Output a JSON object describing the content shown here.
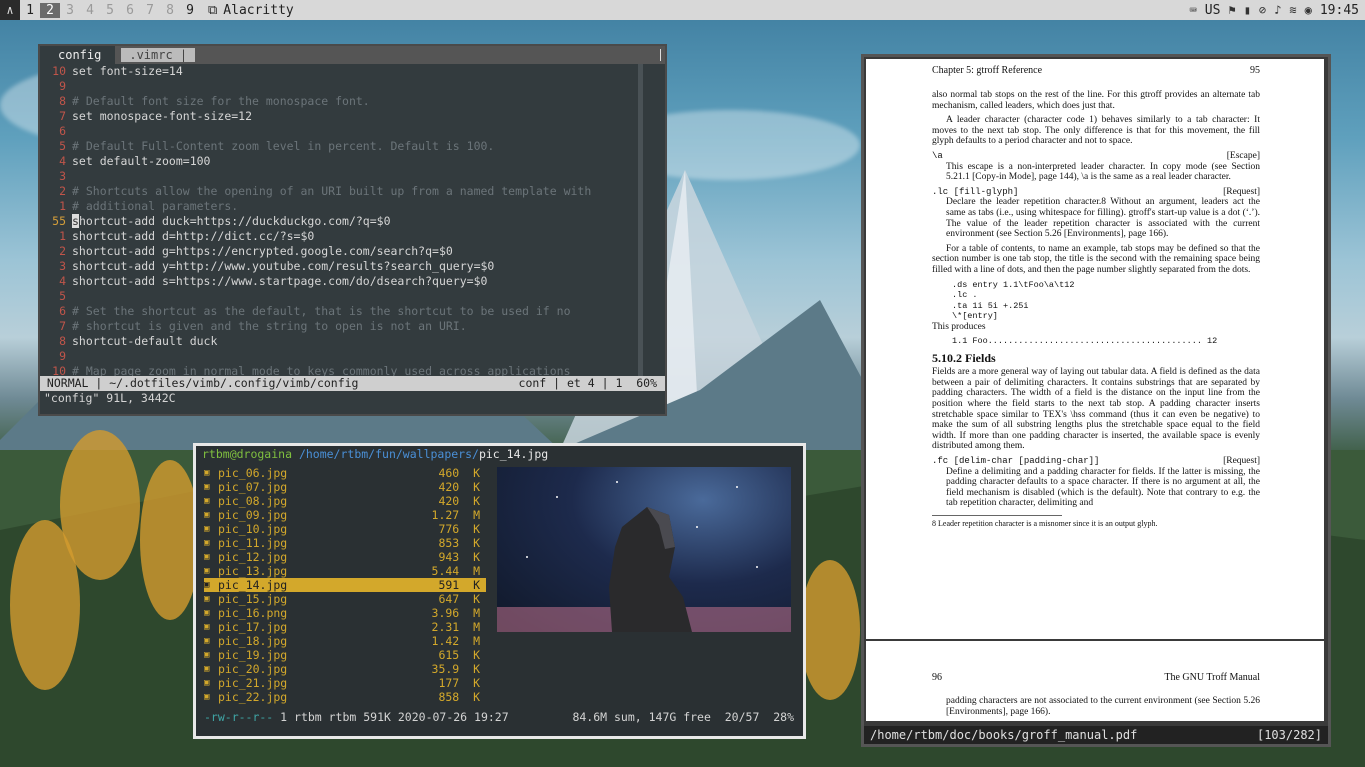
{
  "topbar": {
    "logo": "∧",
    "workspaces": [
      "1",
      "2",
      "3",
      "4",
      "5",
      "6",
      "7",
      "8",
      "9"
    ],
    "active_workspace": "2",
    "window_title": "Alacritty",
    "keyboard_layout": "US",
    "clock": "19:45",
    "icons": [
      "arch-logo-icon",
      "window-icon",
      "keyboard-icon",
      "wifi-icon",
      "volume-icon",
      "battery-icon",
      "discord-icon"
    ]
  },
  "vim": {
    "tab_active": "config",
    "tab_inactive": ".vimrc |",
    "lines": [
      {
        "num": "10",
        "text": "set font-size=14",
        "type": "code"
      },
      {
        "num": "9",
        "text": "",
        "type": "code"
      },
      {
        "num": "8",
        "text": "# Default font size for the monospace font.",
        "type": "comment"
      },
      {
        "num": "7",
        "text": "set monospace-font-size=12",
        "type": "code"
      },
      {
        "num": "6",
        "text": "",
        "type": "code"
      },
      {
        "num": "5",
        "text": "# Default Full-Content zoom level in percent. Default is 100.",
        "type": "comment"
      },
      {
        "num": "4",
        "text": "set default-zoom=100",
        "type": "code"
      },
      {
        "num": "3",
        "text": "",
        "type": "code"
      },
      {
        "num": "2",
        "text": "# Shortcuts allow the opening of an URI built up from a named template with",
        "type": "comment"
      },
      {
        "num": "1",
        "text": "# additional parameters.",
        "type": "comment"
      },
      {
        "num": "55",
        "text": "shortcut-add duck=https://duckduckgo.com/?q=$0",
        "type": "current"
      },
      {
        "num": "1",
        "text": "shortcut-add d=http://dict.cc/?s=$0",
        "type": "code"
      },
      {
        "num": "2",
        "text": "shortcut-add g=https://encrypted.google.com/search?q=$0",
        "type": "code"
      },
      {
        "num": "3",
        "text": "shortcut-add y=http://www.youtube.com/results?search_query=$0",
        "type": "code"
      },
      {
        "num": "4",
        "text": "shortcut-add s=https://www.startpage.com/do/dsearch?query=$0",
        "type": "code"
      },
      {
        "num": "5",
        "text": "",
        "type": "code"
      },
      {
        "num": "6",
        "text": "# Set the shortcut as the default, that is the shortcut to be used if no",
        "type": "comment"
      },
      {
        "num": "7",
        "text": "# shortcut is given and the string to open is not an URI.",
        "type": "comment"
      },
      {
        "num": "8",
        "text": "shortcut-default duck",
        "type": "code"
      },
      {
        "num": "9",
        "text": "",
        "type": "code"
      },
      {
        "num": "10",
        "text": "# Map page zoom in normal mode to keys commonly used across applications",
        "type": "comment"
      }
    ],
    "status_left": " NORMAL | ~/.dotfiles/vimb/.config/vimb/config",
    "status_right": "conf | et 4 | 1  60%",
    "cmdline": "\"config\" 91L, 3442C"
  },
  "ranger": {
    "user": "rtbm@drogaina",
    "path": " /home/rtbm/fun/wallpapers/",
    "file": "pic_14.jpg",
    "files": [
      {
        "name": "pic_06.jpg",
        "size": "460  K"
      },
      {
        "name": "pic_07.jpg",
        "size": "420  K"
      },
      {
        "name": "pic_08.jpg",
        "size": "420  K"
      },
      {
        "name": "pic_09.jpg",
        "size": "1.27  M"
      },
      {
        "name": "pic_10.jpg",
        "size": "776  K"
      },
      {
        "name": "pic_11.jpg",
        "size": "853  K"
      },
      {
        "name": "pic_12.jpg",
        "size": "943  K"
      },
      {
        "name": "pic_13.jpg",
        "size": "5.44  M"
      },
      {
        "name": "pic_14.jpg",
        "size": "591  K",
        "selected": true
      },
      {
        "name": "pic_15.jpg",
        "size": "647  K"
      },
      {
        "name": "pic_16.png",
        "size": "3.96  M"
      },
      {
        "name": "pic_17.jpg",
        "size": "2.31  M"
      },
      {
        "name": "pic_18.jpg",
        "size": "1.42  M"
      },
      {
        "name": "pic_19.jpg",
        "size": "615  K"
      },
      {
        "name": "pic_20.jpg",
        "size": "35.9  K"
      },
      {
        "name": "pic_21.jpg",
        "size": "177  K"
      },
      {
        "name": "pic_22.jpg",
        "size": "858  K"
      }
    ],
    "footer_perm": "-rw-r--r--",
    "footer_info": " 1 rtbm rtbm 591K 2020-07-26 19:27",
    "footer_right": "84.6M sum, 147G free  20/57  28%"
  },
  "pdf": {
    "header_left": "Chapter 5: gtroff Reference",
    "header_right": "95",
    "p1": "also normal tab stops on the rest of the line. For this gtroff provides an alternate tab mechanism, called leaders, which does just that.",
    "p2": "A leader character (character code 1) behaves similarly to a tab character: It moves to the next tab stop. The only difference is that for this movement, the fill glyph defaults to a period character and not to space.",
    "req1_name": "\\a",
    "req1_tag": "[Escape]",
    "req1_text": "This escape is a non-interpreted leader character. In copy mode (see Section 5.21.1 [Copy-in Mode], page 144), \\a is the same as a real leader character.",
    "req2_name": ".lc [fill-glyph]",
    "req2_tag": "[Request]",
    "req2_text": "Declare the leader repetition character.8 Without an argument, leaders act the same as tabs (i.e., using whitespace for filling). gtroff's start-up value is a dot (‘.’). The value of the leader repetition character is associated with the current environment (see Section 5.26 [Environments], page 166).",
    "p3": "For a table of contents, to name an example, tab stops may be defined so that the section number is one tab stop, the title is the second with the remaining space being filled with a line of dots, and then the page number slightly separated from the dots.",
    "code": [
      ".ds entry 1.1\\tFoo\\a\\t12",
      ".lc .",
      ".ta 1i 5i +.25i",
      "\\*[entry]"
    ],
    "produces": "This produces",
    "produces_line": "1.1  Foo..........................................  12",
    "section": "5.10.2  Fields",
    "p4": "Fields are a more general way of laying out tabular data. A field is defined as the data between a pair of delimiting characters. It contains substrings that are separated by padding characters. The width of a field is the distance on the input line from the position where the field starts to the next tab stop. A padding character inserts stretchable space similar to TEX's \\hss command (thus it can even be negative) to make the sum of all substring lengths plus the stretchable space equal to the field width. If more than one padding character is inserted, the available space is evenly distributed among them.",
    "req3_name": ".fc [delim-char [padding-char]]",
    "req3_tag": "[Request]",
    "req3_text": "Define a delimiting and a padding character for fields. If the latter is missing, the padding character defaults to a space character. If there is no argument at all, the field mechanism is disabled (which is the default). Note that contrary to e.g. the tab repetition character, delimiting and",
    "footnote": "8  Leader repetition character is a misnomer since it is an output glyph.",
    "page2_left": "96",
    "page2_right": "The GNU Troff Manual",
    "page2_text": "padding characters are not associated to the current environment (see Section 5.26 [Environments], page 166).",
    "status_path": "/home/rtbm/doc/books/groff_manual.pdf",
    "status_pos": "[103/282]"
  }
}
